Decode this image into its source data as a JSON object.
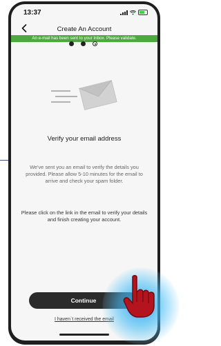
{
  "status_bar": {
    "time": "13:37"
  },
  "nav": {
    "title": "Create An Account"
  },
  "banner": {
    "text": "An e-mail has been sent to your Inbox. Please validate."
  },
  "steps": {
    "total": 3,
    "current": 3
  },
  "main": {
    "heading": "Verify your email address",
    "description": "We've sent you an email to verify the details you provided. Please allow 5-10 minutes for the email to arrive and check your spam folder.",
    "instruction": "Please click on the link in the email to verify your details and finish creating your account."
  },
  "actions": {
    "continue_label": "Continue",
    "not_received_label": "I haven`t received the email"
  },
  "colors": {
    "banner": "#4ea840",
    "button": "#2b2b2b",
    "tap_highlight": "#30a8f0",
    "cursor": "#b3141d"
  },
  "icons": [
    "back-chevron-icon",
    "signal-icon",
    "wifi-icon",
    "battery-icon",
    "envelope-icon",
    "hand-pointer-icon"
  ]
}
